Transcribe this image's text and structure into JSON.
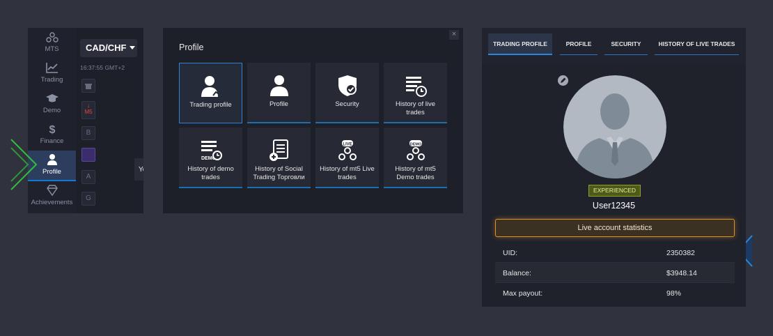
{
  "sidebar": {
    "items": [
      {
        "label": "MTS",
        "icon": "mts-icon"
      },
      {
        "label": "Trading",
        "icon": "chart-icon"
      },
      {
        "label": "Demo",
        "icon": "graduation-cap-icon"
      },
      {
        "label": "Finance",
        "icon": "dollar-icon"
      },
      {
        "label": "Profile",
        "icon": "user-icon"
      },
      {
        "label": "Achievements",
        "icon": "diamond-icon"
      }
    ]
  },
  "chart": {
    "pair": "CAD/CHF",
    "time": "16:37:55 GMT+2",
    "tools": [
      "",
      "M5",
      "B",
      "",
      "A",
      "G"
    ]
  },
  "tooltip": "Your profile's info",
  "profile_menu": {
    "title": "Profile",
    "close": "×",
    "tiles": [
      {
        "label": "Trading profile",
        "icon": "trading-profile-icon"
      },
      {
        "label": "Profile",
        "icon": "user-icon"
      },
      {
        "label": "Security",
        "icon": "shield-icon"
      },
      {
        "label": "History of live trades",
        "icon": "history-icon"
      },
      {
        "label": "History of demo trades",
        "icon": "demo-history-icon"
      },
      {
        "label": "History of Social Trading Торговли",
        "icon": "document-icon"
      },
      {
        "label": "History of mt5 Live trades",
        "icon": "mt5-live-icon"
      },
      {
        "label": "History of mt5 Demo trades",
        "icon": "mt5-demo-icon"
      }
    ]
  },
  "trading_profile": {
    "tabs": [
      "TRADING PROFILE",
      "PROFILE",
      "SECURITY",
      "HISTORY OF LIVE TRADES"
    ],
    "badge": "EXPERIENCED",
    "username": "User12345",
    "stats_button": "Live account statistics",
    "stats": [
      {
        "key": "UID:",
        "value": "2350382"
      },
      {
        "key": "Balance:",
        "value": "$3948.14"
      },
      {
        "key": "Max payout:",
        "value": "98%"
      }
    ]
  },
  "colors": {
    "accent": "#2a86e0",
    "green": "#2fbf3a",
    "orange": "#e0902a"
  }
}
